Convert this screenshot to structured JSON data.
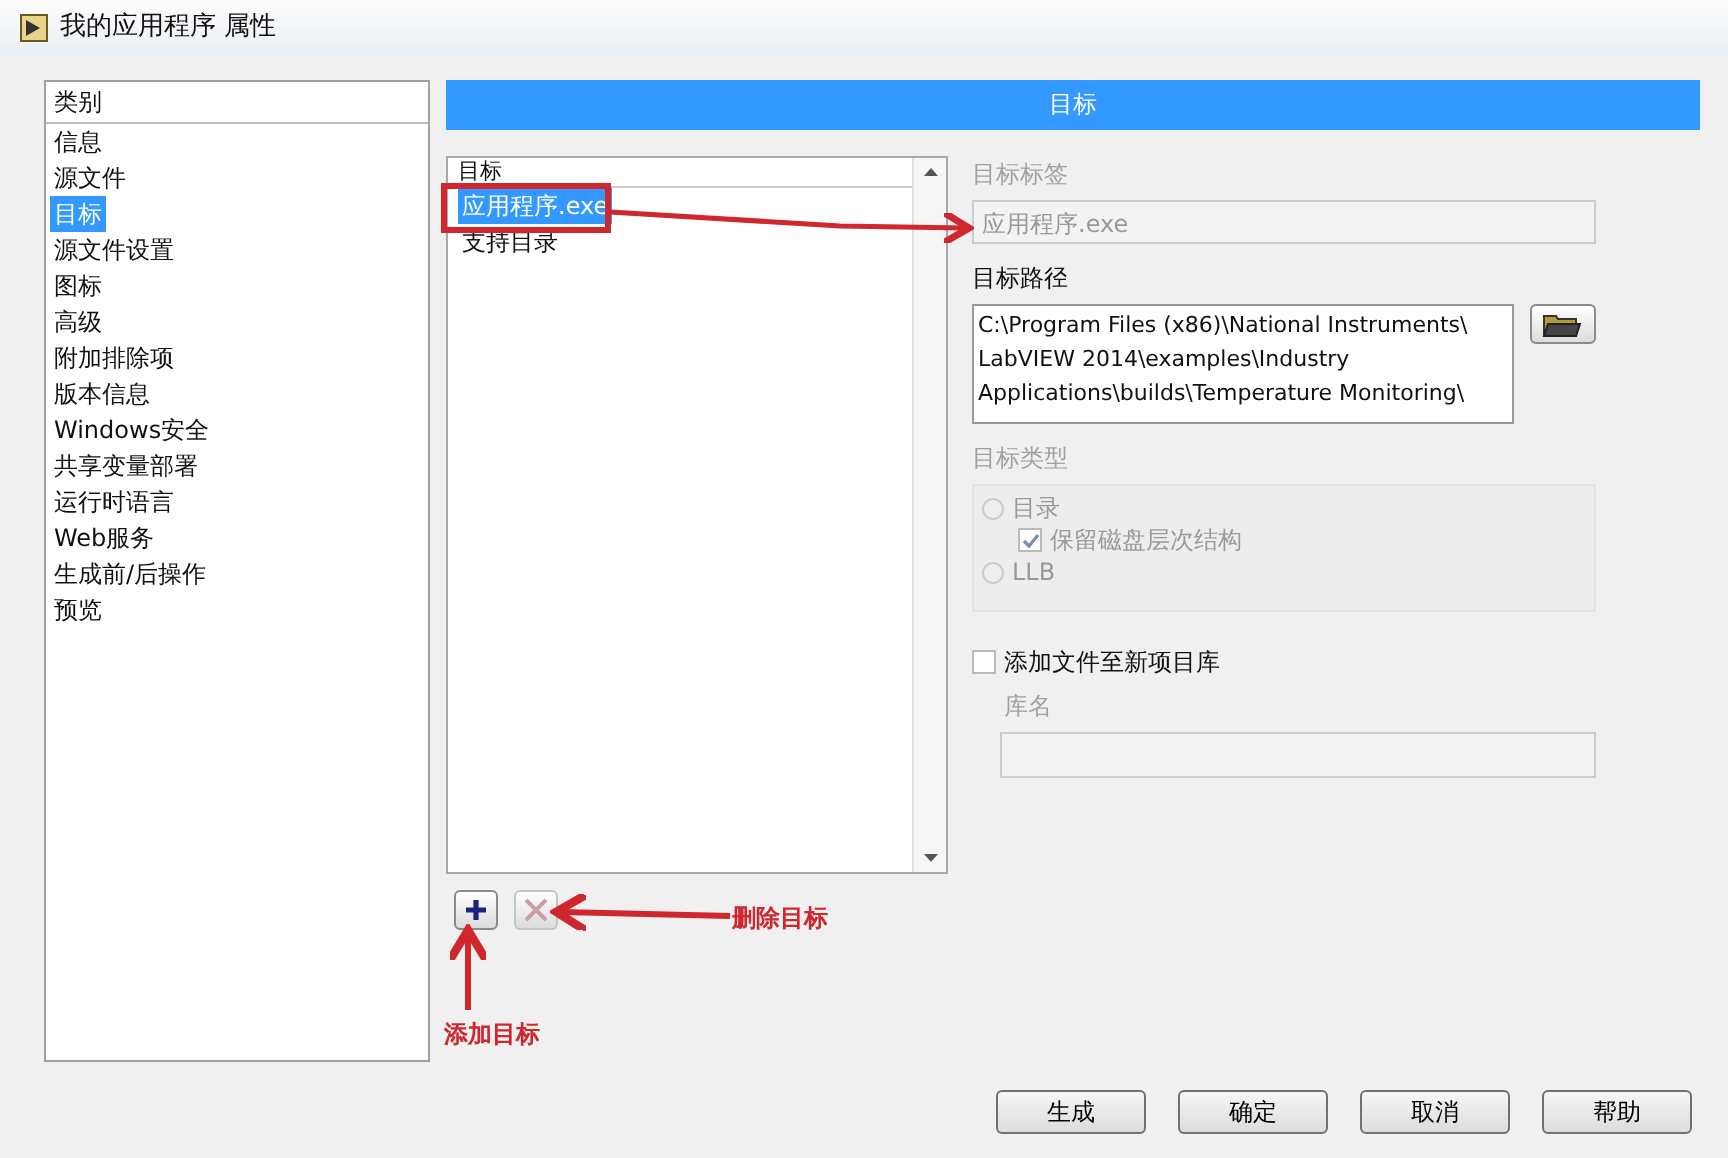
{
  "window": {
    "title": "我的应用程序 属性"
  },
  "categories": {
    "header": "类别",
    "items": [
      {
        "label": "信息",
        "selected": false
      },
      {
        "label": "源文件",
        "selected": false
      },
      {
        "label": "目标",
        "selected": true
      },
      {
        "label": "源文件设置",
        "selected": false
      },
      {
        "label": "图标",
        "selected": false
      },
      {
        "label": "高级",
        "selected": false
      },
      {
        "label": "附加排除项",
        "selected": false
      },
      {
        "label": "版本信息",
        "selected": false
      },
      {
        "label": "Windows安全",
        "selected": false
      },
      {
        "label": "共享变量部署",
        "selected": false
      },
      {
        "label": "运行时语言",
        "selected": false
      },
      {
        "label": "Web服务",
        "selected": false
      },
      {
        "label": "生成前/后操作",
        "selected": false
      },
      {
        "label": "预览",
        "selected": false
      }
    ]
  },
  "panel_title": "目标",
  "targets": {
    "header": "目标",
    "items": [
      {
        "label": "应用程序.exe",
        "selected": true
      },
      {
        "label": "支持目录",
        "selected": false
      }
    ],
    "remove_disabled": true
  },
  "form": {
    "target_label": {
      "label": "目标标签",
      "value": "应用程序.exe",
      "disabled": true
    },
    "target_path": {
      "label": "目标路径",
      "lines": [
        "C:\\Program Files (x86)\\National Instruments\\",
        "LabVIEW 2014\\examples\\Industry",
        "Applications\\builds\\Temperature Monitoring\\"
      ]
    },
    "target_type": {
      "label": "目标类型",
      "disabled": true,
      "options": [
        {
          "kind": "radio",
          "label": "目录",
          "checked": false
        },
        {
          "kind": "checkbox",
          "label": "保留磁盘层次结构",
          "checked": true
        },
        {
          "kind": "radio",
          "label": "LLB",
          "checked": false
        }
      ]
    },
    "add_to_library": {
      "label": "添加文件至新项目库",
      "checked": false
    },
    "library_name": {
      "label": "库名",
      "disabled": true
    }
  },
  "buttons": [
    {
      "label": "生成"
    },
    {
      "label": "确定"
    },
    {
      "label": "取消"
    },
    {
      "label": "帮助"
    }
  ],
  "annotations": [
    {
      "text": "删除目标"
    },
    {
      "text": "添加目标"
    }
  ]
}
